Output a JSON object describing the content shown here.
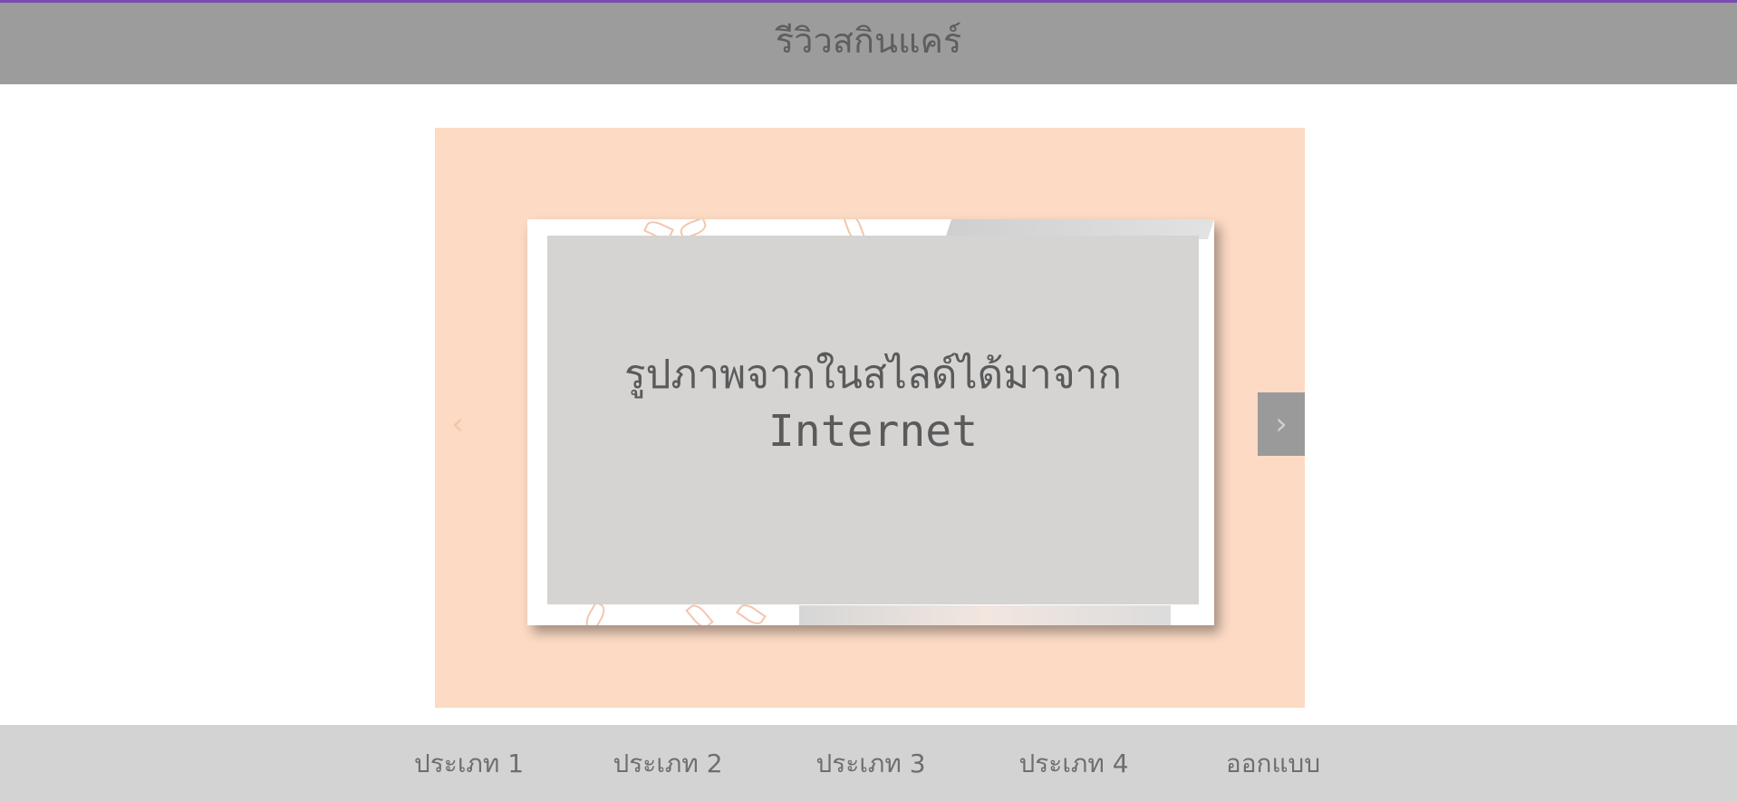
{
  "header": {
    "title": "รีวิวสกินแคร์"
  },
  "slider": {
    "caption_line1": "รูปภาพจากในสไลด์ได้มาจาก",
    "caption_line2": "Internet",
    "prev_label": "‹",
    "next_label": "›",
    "background_color": "#fcdac4"
  },
  "nav": {
    "items": [
      {
        "label": "ประเภท 1"
      },
      {
        "label": "ประเภท 2"
      },
      {
        "label": "ประเภท 3"
      },
      {
        "label": "ประเภท 4"
      },
      {
        "label": "ออกแบบ"
      }
    ]
  },
  "colors": {
    "accent_top_line": "#7b4bb0",
    "header_bg": "#9c9c9c",
    "nav_bg": "#d3d3d3"
  }
}
